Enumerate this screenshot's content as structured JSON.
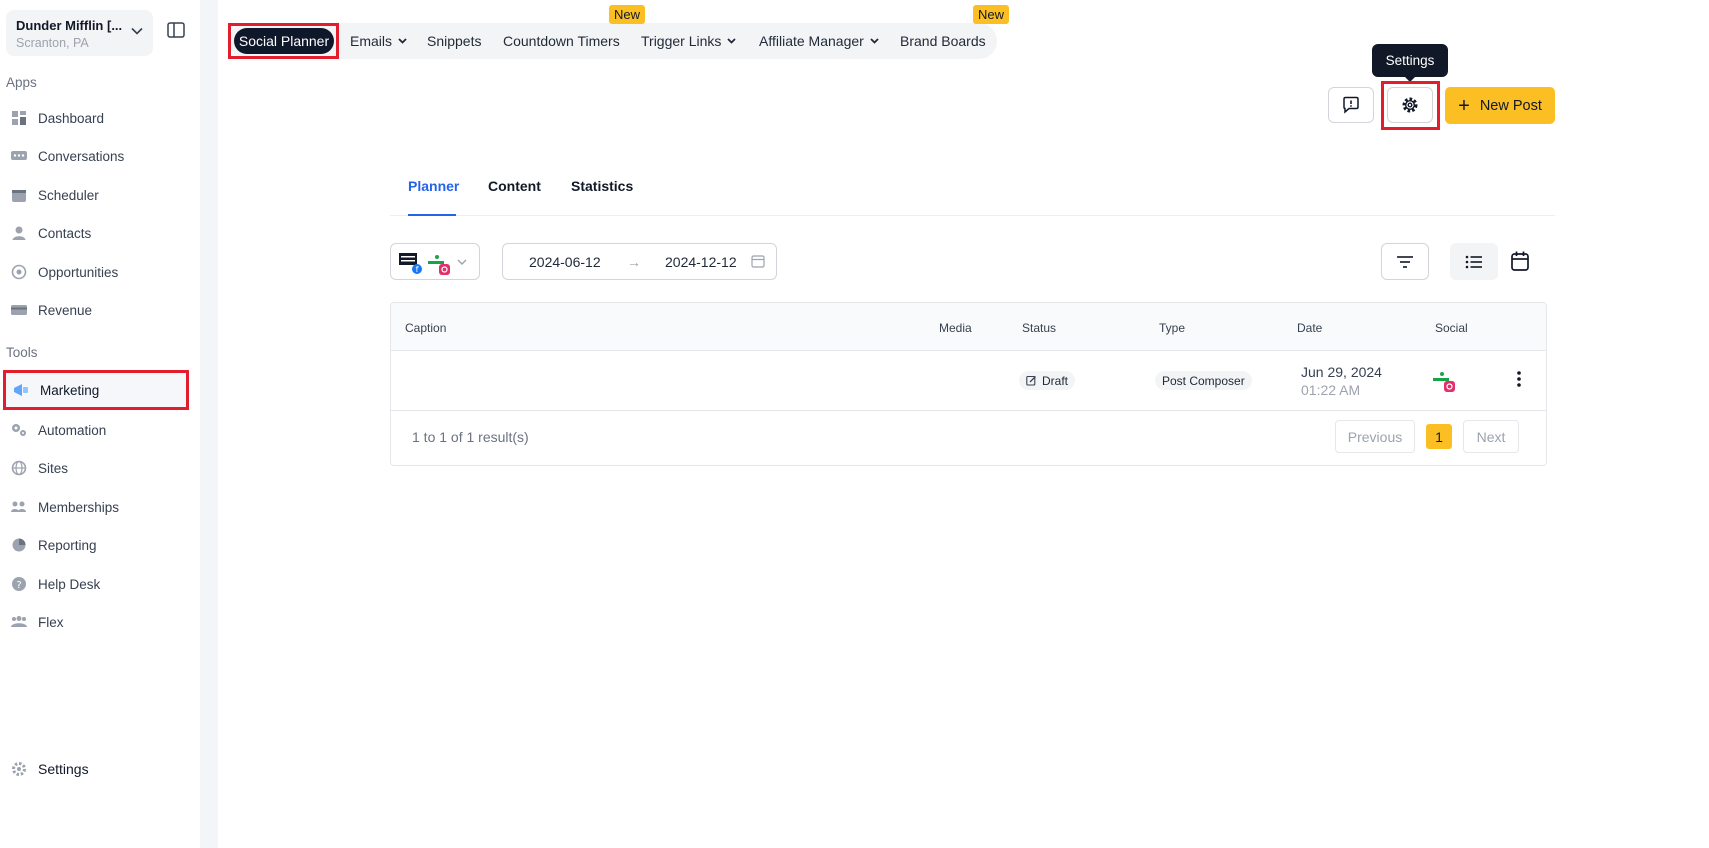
{
  "account": {
    "name": "Dunder Mifflin [...",
    "location": "Scranton, PA"
  },
  "sidebar": {
    "apps_title": "Apps",
    "tools_title": "Tools",
    "apps": [
      {
        "label": "Dashboard",
        "icon": "dashboard-icon"
      },
      {
        "label": "Conversations",
        "icon": "chat-icon"
      },
      {
        "label": "Scheduler",
        "icon": "calendar-icon"
      },
      {
        "label": "Contacts",
        "icon": "person-icon"
      },
      {
        "label": "Opportunities",
        "icon": "target-icon"
      },
      {
        "label": "Revenue",
        "icon": "card-icon"
      }
    ],
    "tools": [
      {
        "label": "Marketing",
        "icon": "megaphone-icon"
      },
      {
        "label": "Automation",
        "icon": "gears-icon"
      },
      {
        "label": "Sites",
        "icon": "globe-icon"
      },
      {
        "label": "Memberships",
        "icon": "group-icon"
      },
      {
        "label": "Reporting",
        "icon": "pie-icon"
      },
      {
        "label": "Help Desk",
        "icon": "help-icon"
      },
      {
        "label": "Flex",
        "icon": "users-icon"
      }
    ],
    "settings_label": "Settings"
  },
  "topnav": {
    "tabs": [
      {
        "label": "Social Planner"
      },
      {
        "label": "Emails"
      },
      {
        "label": "Snippets"
      },
      {
        "label": "Countdown Timers"
      },
      {
        "label": "Trigger Links"
      },
      {
        "label": "Affiliate Manager"
      },
      {
        "label": "Brand Boards"
      }
    ],
    "badge_new": "New"
  },
  "toolbar": {
    "tooltip": "Settings",
    "new_post": "New Post"
  },
  "subtabs": [
    {
      "label": "Planner"
    },
    {
      "label": "Content"
    },
    {
      "label": "Statistics"
    }
  ],
  "filters": {
    "start_date": "2024-06-12",
    "end_date": "2024-12-12",
    "arrow": "→"
  },
  "table": {
    "headers": {
      "caption": "Caption",
      "media": "Media",
      "status": "Status",
      "type": "Type",
      "date": "Date",
      "social": "Social"
    },
    "rows": [
      {
        "status": "Draft",
        "type": "Post Composer",
        "date": "Jun 29, 2024",
        "time": "01:22 AM"
      }
    ],
    "results": "1 to 1 of 1 result(s)",
    "previous": "Previous",
    "page": "1",
    "next": "Next"
  },
  "colors": {
    "accent": "#fbbf24",
    "highlight": "#e11d2e",
    "active_tab_bg": "#0f172a",
    "link_blue": "#2563eb"
  }
}
